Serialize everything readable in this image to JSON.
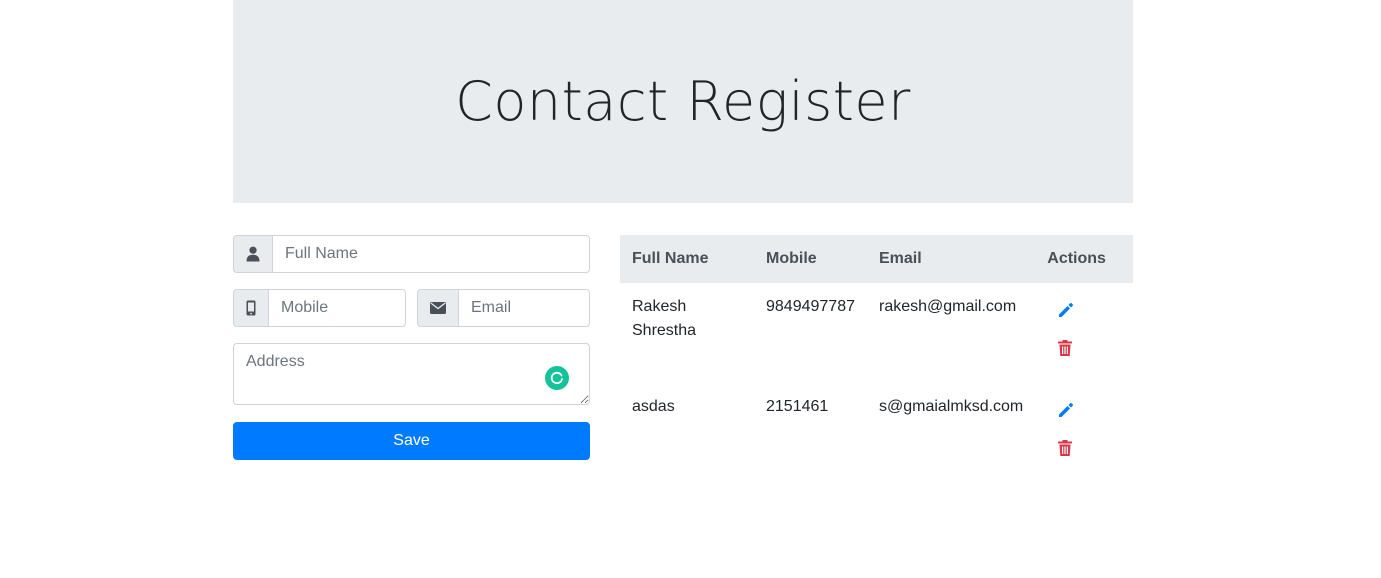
{
  "header": {
    "title": "Contact Register"
  },
  "form": {
    "fullname_placeholder": "Full Name",
    "mobile_placeholder": "Mobile",
    "email_placeholder": "Email",
    "address_placeholder": "Address",
    "save_label": "Save",
    "icons": {
      "fullname": "user-icon",
      "mobile": "mobile-icon",
      "email": "envelope-icon",
      "grammar": "grammarly-icon"
    }
  },
  "table": {
    "headers": [
      "Full Name",
      "Mobile",
      "Email",
      "Actions"
    ],
    "rows": [
      {
        "fullname": "Rakesh Shrestha",
        "mobile": "9849497787",
        "email": "rakesh@gmail.com"
      },
      {
        "fullname": "asdas",
        "mobile": "2151461",
        "email": "s@gmaialmksd.com"
      }
    ],
    "action_icons": {
      "edit": "pencil-icon",
      "delete": "trash-icon"
    }
  },
  "colors": {
    "jumbotron_bg": "#e9ecef",
    "primary": "#007bff",
    "danger": "#dc3545",
    "grammarly": "#15c39a"
  }
}
